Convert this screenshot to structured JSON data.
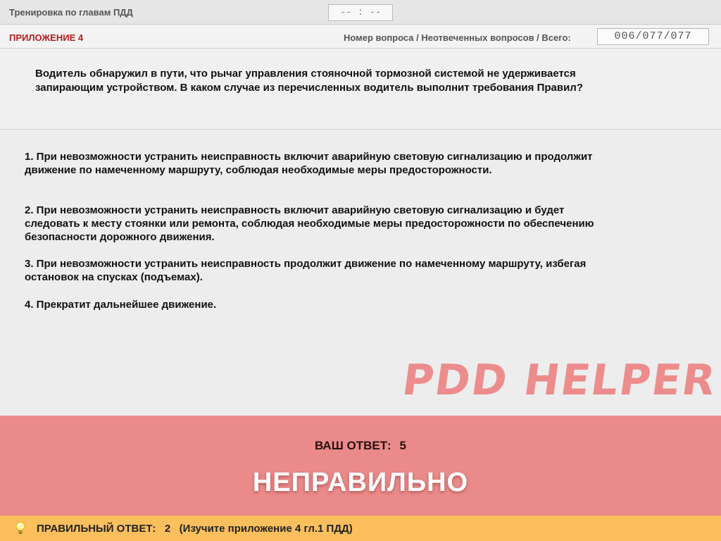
{
  "header": {
    "title": "Тренировка по главам ПДД",
    "timer": "-- : --"
  },
  "info": {
    "appendix": "ПРИЛОЖЕНИЕ 4",
    "counter_label": "Номер вопроса / Неотвеченных вопросов / Всего:",
    "counter_value": "006/077/077"
  },
  "question": {
    "text": "Водитель обнаружил в пути, что рычаг управления стояночной тормозной системой не удерживается запирающим устройством. В каком случае из перечисленных водитель выполнит требования Правил?"
  },
  "answers": [
    {
      "text": "1.  При невозможности устранить неисправность включит аварийную световую сигнализацию и продолжит движение по намеченному маршруту, соблюдая необходимые меры предосторожности."
    },
    {
      "text": "2.  При невозможности устранить неисправность включит аварийную световую сигнализацию и будет следовать к месту стоянки или ремонта, соблюдая необходимые меры предосторожности по обеспечению безопасности дорожного движения."
    },
    {
      "text": "3.  При невозможности устранить неисправность продолжит движение по намеченному маршруту, избегая остановок на спусках (подъемах)."
    },
    {
      "text": "4.  Прекратит дальнейшее движение."
    }
  ],
  "watermark": "PDD HELPER",
  "result": {
    "your_answer_label": "ВАШ  ОТВЕТ:",
    "your_answer_value": "5",
    "verdict": "НЕПРАВИЛЬНО"
  },
  "correct": {
    "text": "ПРАВИЛЬНЫЙ ОТВЕТ:   2   (Изучите приложение 4 гл.1 ПДД)"
  },
  "colors": {
    "result_bg": "#ea8a8a",
    "correct_bg": "#fbbf5e",
    "appendix": "#b01d1d",
    "watermark": "#ec8c8c"
  }
}
